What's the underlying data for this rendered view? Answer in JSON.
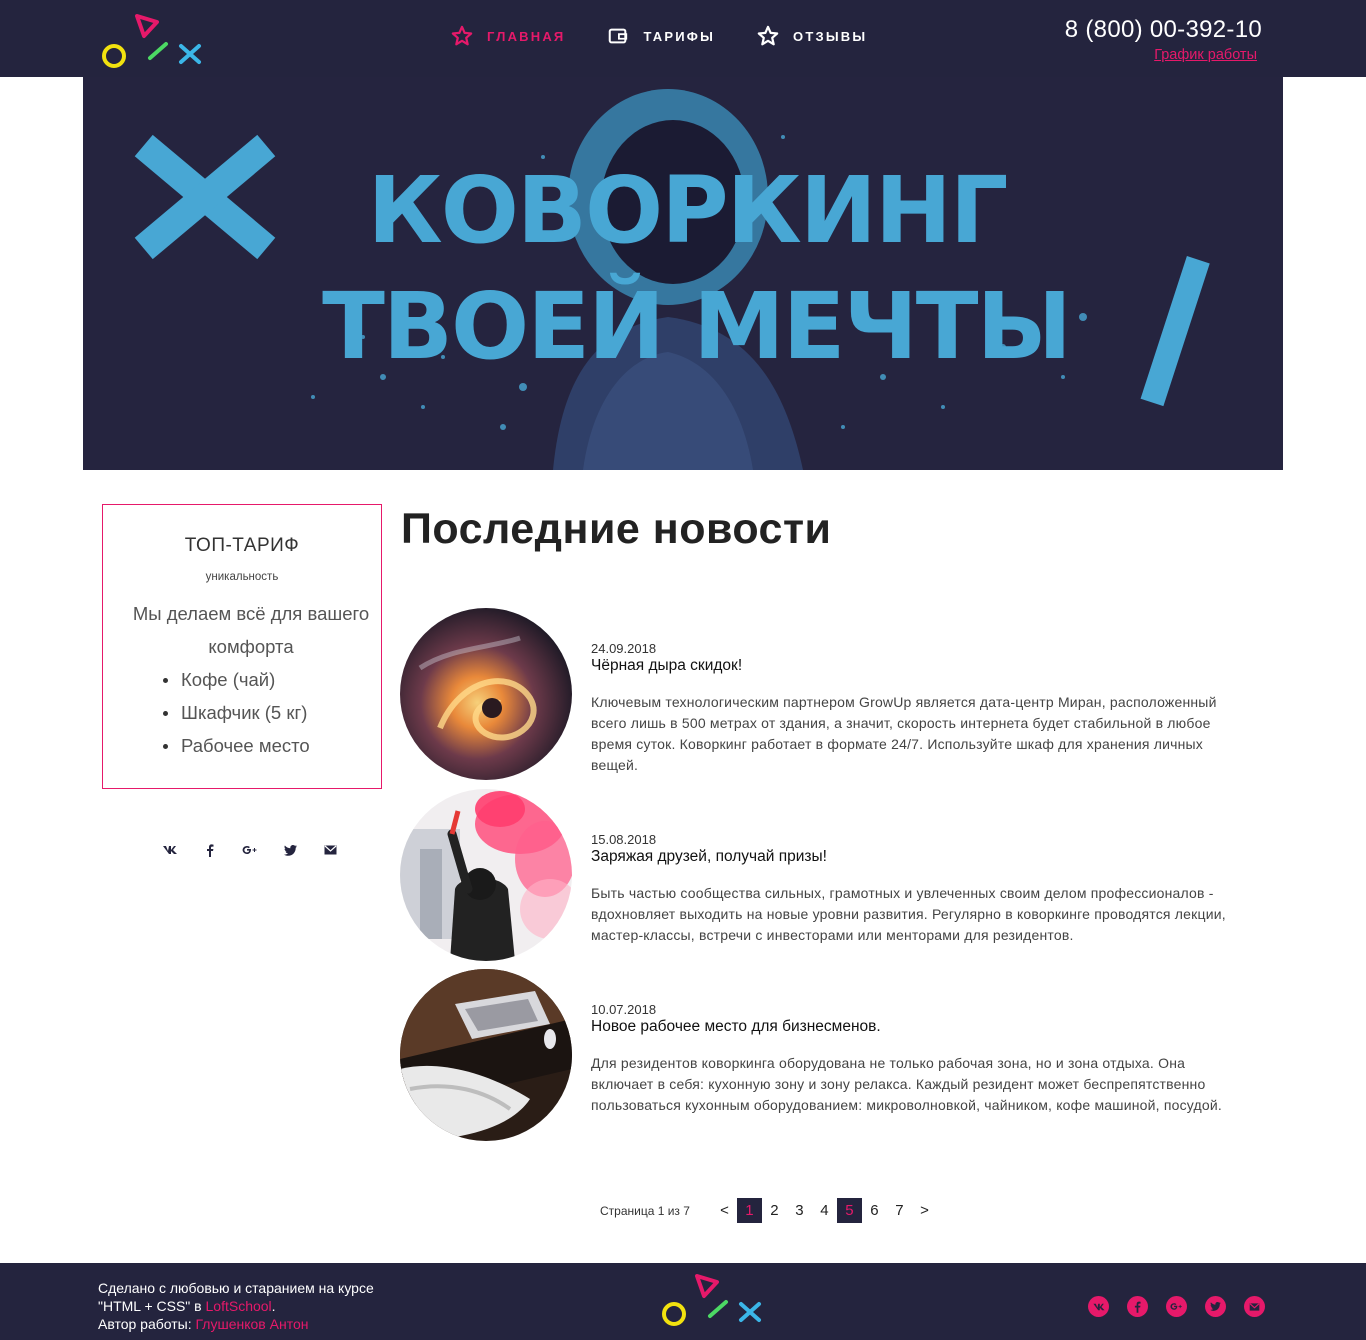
{
  "header": {
    "nav": [
      {
        "label": "ГЛАВНАЯ",
        "icon": "star-icon",
        "active": true
      },
      {
        "label": "ТАРИФЫ",
        "icon": "wallet-icon",
        "active": false
      },
      {
        "label": "ОТЗЫВЫ",
        "icon": "star-icon",
        "active": false
      }
    ],
    "phone": "8 (800) 00-392-10",
    "schedule_link": "График работы"
  },
  "hero": {
    "line1": "КОВОРКИНГ",
    "line2": "ТВОЕЙ МЕЧТЫ"
  },
  "sidebar": {
    "tariff": {
      "title": "ТОП-ТАРИФ",
      "subtitle": "уникальность",
      "text": "Мы делаем всё для вашего комфорта",
      "items": [
        "Кофе (чай)",
        "Шкафчик (5 кг)",
        "Рабочее место"
      ]
    },
    "social": [
      "vk-icon",
      "facebook-icon",
      "google-plus-icon",
      "twitter-icon",
      "mail-icon"
    ]
  },
  "main": {
    "title": "Последние новости",
    "news": [
      {
        "date": "24.09.2018",
        "title": "Чёрная дыра скидок!",
        "text": "Ключевым технологическим партнером GrowUp является дата-центр Миран, расположенный всего лишь в 500 метрах от здания, а значит, скорость интернета будет стабильной в любое время суток. Коворкинг работает в формате 24/7. Используйте шкаф для хранения личных вещей."
      },
      {
        "date": "15.08.2018",
        "title": "Заряжая друзей, получай призы!",
        "text": "Быть частью сообщества сильных, грамотных и увлеченных своим делом профессионалов - вдохновляет выходить на новые уровни развития. Регулярно в коворкинге проводятся лекции, мастер-классы, встречи с инвесторами или менторами для резидентов."
      },
      {
        "date": "10.07.2018",
        "title": "Новое рабочее место для бизнесменов.",
        "text": "Для резидентов коворкинга оборудована не только рабочая зона, но и зона отдыха. Она включает в себя: кухонную зону и зону релакса. Каждый резидент может беспрепятственно пользоваться кухонным оборудованием: микроволновкой, чайником, кофе машиной, посудой."
      }
    ]
  },
  "pagination": {
    "info": "Страница 1 из 7",
    "prev": "<",
    "next": ">",
    "pages": [
      "1",
      "2",
      "3",
      "4",
      "5",
      "6",
      "7"
    ]
  },
  "footer": {
    "text_line1": "Сделано с любовью и старанием на курсе \"HTML + CSS\" в ",
    "school": "LoftSchool",
    "text_after_school": ".",
    "author_label": "Автор работы: ",
    "author": "Глушенков Антон",
    "social": [
      "vk-icon",
      "facebook-icon",
      "google-plus-icon",
      "twitter-icon",
      "mail-icon"
    ]
  },
  "colors": {
    "dark": "#24243e",
    "accent": "#e6196a",
    "hero_blue": "#48a7d4",
    "logo_yellow": "#f2e20f",
    "logo_green": "#4cd964",
    "logo_cyan": "#3bb6e8"
  }
}
